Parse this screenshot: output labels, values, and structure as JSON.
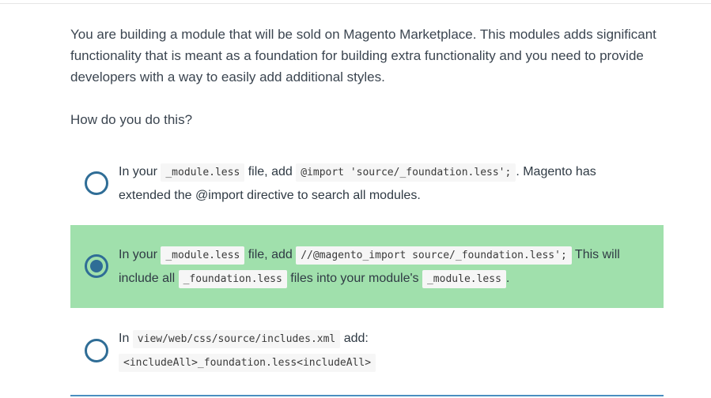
{
  "question": {
    "text": "You are building a module that will be sold on Magento Marketplace. This modules adds significant functionality that is meant as a foundation for building extra functionality and you need to provide developers with a way to easily add additional styles.",
    "prompt": "How do you do this?"
  },
  "options": [
    {
      "selected": false,
      "t1": "In your ",
      "c1": "_module.less",
      "t2": " file, add ",
      "c2": "@import 'source/_foundation.less';",
      "t3": ". Magento has extended the @import directive to search all modules."
    },
    {
      "selected": true,
      "t1": "In your ",
      "c1": "_module.less",
      "t2": " file, add ",
      "c2": "//@magento_import source/_foundation.less';",
      "t3": " This will include all ",
      "c3": "_foundation.less",
      "t4": " files into your module's ",
      "c4": "_module.less",
      "t5": "."
    },
    {
      "selected": false,
      "t1": "In ",
      "c1": "view/web/css/source/includes.xml",
      "t2": " add: ",
      "c2": "<includeAll>_foundation.less<includeAll>"
    }
  ],
  "colors": {
    "selected_background": "#a0e0ac",
    "radio": "#2f6d96",
    "code_background": "#f6f6f6",
    "bottom_rule": "#4a8fc0"
  }
}
